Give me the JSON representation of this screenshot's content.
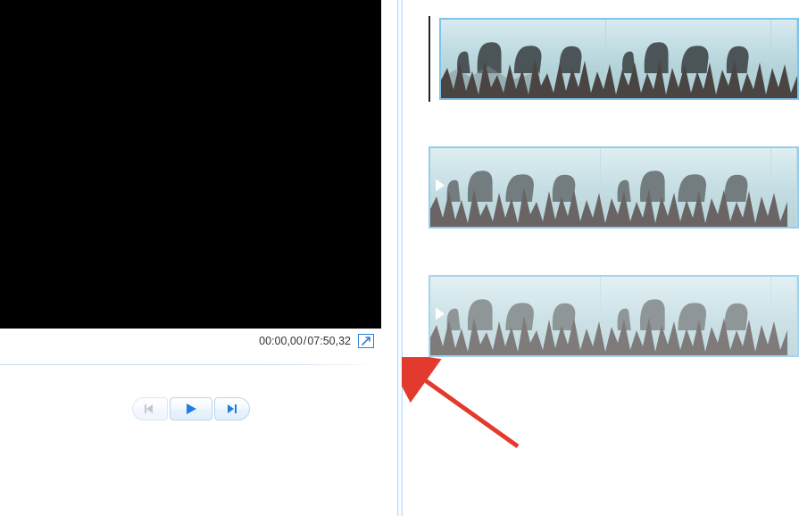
{
  "preview": {
    "current_time": "00:00,00",
    "total_time": "07:50,32"
  },
  "controls": {
    "prev_frame": "Previous frame",
    "play": "Play",
    "next_frame": "Next frame",
    "fullscreen": "Full screen"
  },
  "clips": [
    {
      "selected": true,
      "filmstrip": true,
      "play_marker": false
    },
    {
      "selected": true,
      "filmstrip": false,
      "play_marker": true
    },
    {
      "selected": true,
      "filmstrip": false,
      "play_marker": true
    }
  ],
  "colors": {
    "selection": "#7dc4e8",
    "accent": "#1f7fe0",
    "arrow": "#e23b2e",
    "waveform": "#4a4443"
  }
}
